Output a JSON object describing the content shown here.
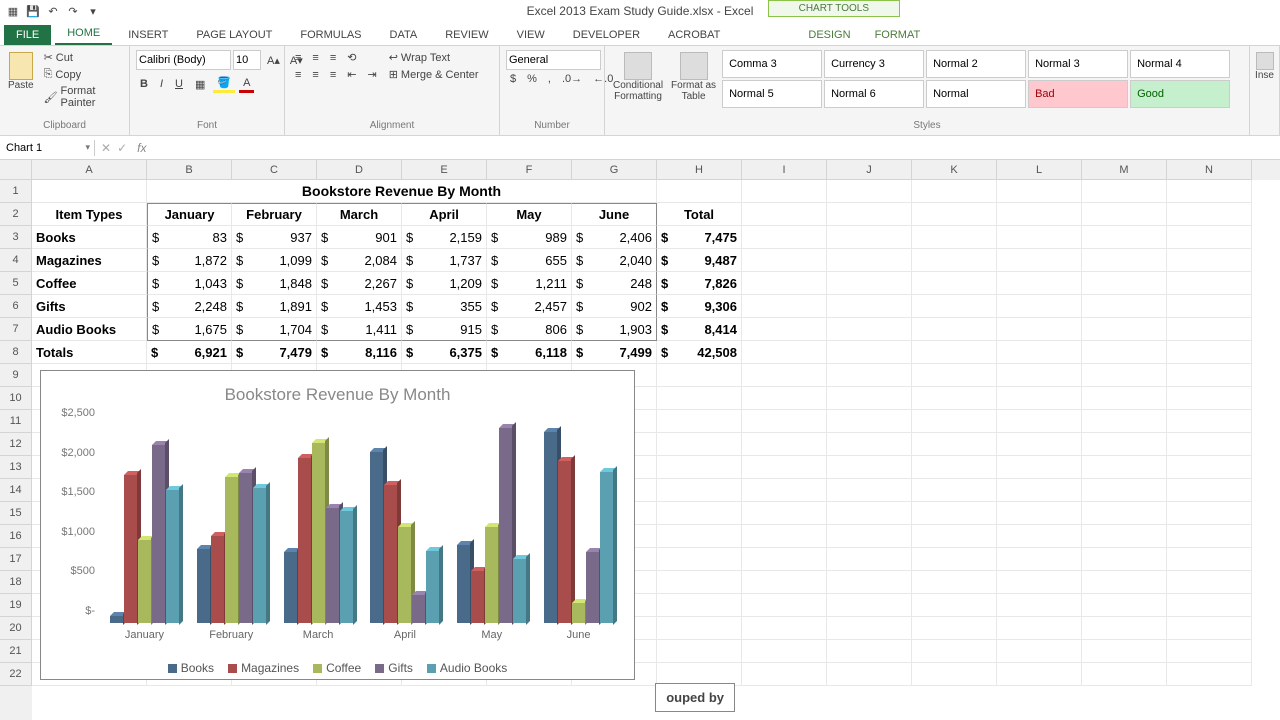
{
  "app": {
    "title": "Excel 2013 Exam Study Guide.xlsx - Excel",
    "context_tool": "CHART TOOLS"
  },
  "tabs": {
    "file": "FILE",
    "home": "HOME",
    "insert": "INSERT",
    "page_layout": "PAGE LAYOUT",
    "formulas": "FORMULAS",
    "data": "DATA",
    "review": "REVIEW",
    "view": "VIEW",
    "developer": "DEVELOPER",
    "acrobat": "ACROBAT",
    "design": "DESIGN",
    "format": "FORMAT"
  },
  "ribbon": {
    "paste": "Paste",
    "cut": "Cut",
    "copy": "Copy",
    "fp": "Format Painter",
    "clipboard": "Clipboard",
    "font_name": "Calibri (Body)",
    "font_size": "10",
    "font": "Font",
    "wrap": "Wrap Text",
    "merge": "Merge & Center",
    "alignment": "Alignment",
    "num_format": "General",
    "number": "Number",
    "cond": "Conditional\nFormatting",
    "fmt_table": "Format as\nTable",
    "styles": {
      "a": "Comma 3",
      "b": "Currency 3",
      "c": "Normal 2",
      "d": "Normal 3",
      "e": "Normal 4",
      "f": "Normal 5",
      "g": "Normal 6",
      "h": "Normal",
      "i": "Bad",
      "j": "Good"
    },
    "styles_label": "Styles",
    "insert_btn": "Inse"
  },
  "name_box": "Chart 1",
  "sheet": {
    "cols": [
      "A",
      "B",
      "C",
      "D",
      "E",
      "F",
      "G",
      "H",
      "I",
      "J",
      "K",
      "L",
      "M",
      "N"
    ],
    "rows": [
      "1",
      "2",
      "3",
      "4",
      "5",
      "6",
      "7",
      "8",
      "9",
      "10",
      "11",
      "12",
      "13",
      "14",
      "15",
      "16",
      "17",
      "18",
      "19",
      "20",
      "21",
      "22"
    ],
    "title": "Bookstore Revenue By Month",
    "headers": [
      "Item Types",
      "January",
      "February",
      "March",
      "April",
      "May",
      "June",
      "Total"
    ],
    "data": [
      {
        "name": "Books",
        "v": [
          "83",
          "937",
          "901",
          "2,159",
          "989",
          "2,406"
        ],
        "total": "7,475"
      },
      {
        "name": "Magazines",
        "v": [
          "1,872",
          "1,099",
          "2,084",
          "1,737",
          "655",
          "2,040"
        ],
        "total": "9,487"
      },
      {
        "name": "Coffee",
        "v": [
          "1,043",
          "1,848",
          "2,267",
          "1,209",
          "1,211",
          "248"
        ],
        "total": "7,826"
      },
      {
        "name": "Gifts",
        "v": [
          "2,248",
          "1,891",
          "1,453",
          "355",
          "2,457",
          "902"
        ],
        "total": "9,306"
      },
      {
        "name": "Audio Books",
        "v": [
          "1,675",
          "1,704",
          "1,411",
          "915",
          "806",
          "1,903"
        ],
        "total": "8,414"
      }
    ],
    "totals_label": "Totals",
    "totals": [
      "6,921",
      "7,479",
      "8,116",
      "6,375",
      "6,118",
      "7,499"
    ],
    "grand_total": "42,508"
  },
  "chart_data": {
    "type": "bar",
    "title": "Bookstore Revenue By Month",
    "categories": [
      "January",
      "February",
      "March",
      "April",
      "May",
      "June"
    ],
    "series": [
      {
        "name": "Books",
        "color": "#4a6a8a",
        "values": [
          83,
          937,
          901,
          2159,
          989,
          2406
        ]
      },
      {
        "name": "Magazines",
        "color": "#a84c4c",
        "values": [
          1872,
          1099,
          2084,
          1737,
          655,
          2040
        ]
      },
      {
        "name": "Coffee",
        "color": "#a8b85c",
        "values": [
          1043,
          1848,
          2267,
          1209,
          1211,
          248
        ]
      },
      {
        "name": "Gifts",
        "color": "#7a6a8a",
        "values": [
          2248,
          1891,
          1453,
          355,
          2457,
          902
        ]
      },
      {
        "name": "Audio Books",
        "color": "#5aa0b0",
        "values": [
          1675,
          1704,
          1411,
          915,
          806,
          1903
        ]
      }
    ],
    "ylabel": "",
    "xlabel": "",
    "ylim": [
      0,
      2500
    ],
    "yticks": [
      "$-",
      "$500",
      "$1,000",
      "$1,500",
      "$2,000",
      "$2,500"
    ]
  },
  "callout": "ouped by"
}
